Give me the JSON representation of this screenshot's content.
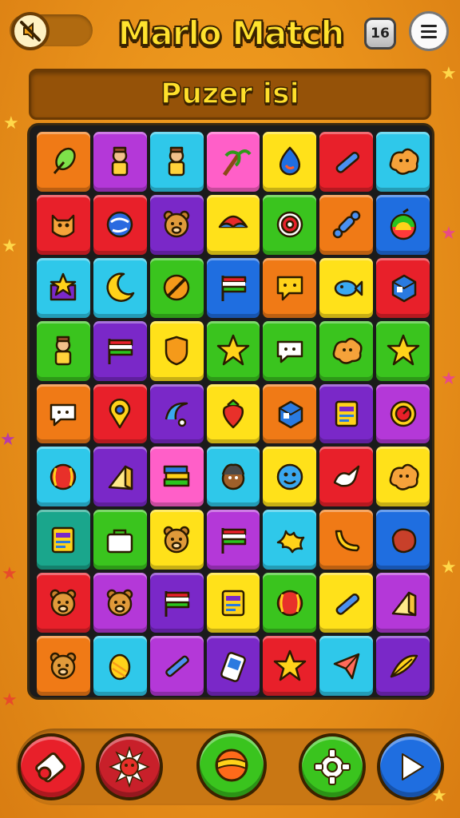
{
  "header": {
    "title": "Marlo Match",
    "moves": "16",
    "subtitle": "Puzer isi"
  },
  "colors": {
    "orange": "#f07a16",
    "magenta": "#b438d8",
    "cyan": "#2fc8ea",
    "pink": "#ff5fc8",
    "yellow": "#ffe11a",
    "red": "#e8202a",
    "purple": "#7a28c8",
    "green": "#3ac41e",
    "blue": "#1f6ee0",
    "teal": "#1aa68c"
  },
  "board": {
    "rows": 9,
    "cols": 7,
    "tiles": [
      [
        {
          "c": "orange",
          "i": "leaf"
        },
        {
          "c": "magenta",
          "i": "doll"
        },
        {
          "c": "cyan",
          "i": "doll"
        },
        {
          "c": "pink",
          "i": "palm"
        },
        {
          "c": "yellow",
          "i": "drop"
        },
        {
          "c": "red",
          "i": "wand"
        },
        {
          "c": "cyan",
          "i": "blob"
        }
      ],
      [
        {
          "c": "red",
          "i": "creature"
        },
        {
          "c": "red",
          "i": "globe"
        },
        {
          "c": "purple",
          "i": "bear"
        },
        {
          "c": "yellow",
          "i": "umbrella"
        },
        {
          "c": "green",
          "i": "target"
        },
        {
          "c": "orange",
          "i": "bone"
        },
        {
          "c": "blue",
          "i": "rainbow"
        }
      ],
      [
        {
          "c": "cyan",
          "i": "box-star"
        },
        {
          "c": "cyan",
          "i": "moon"
        },
        {
          "c": "green",
          "i": "no-sign"
        },
        {
          "c": "blue",
          "i": "flag"
        },
        {
          "c": "orange",
          "i": "speech"
        },
        {
          "c": "yellow",
          "i": "fish"
        },
        {
          "c": "red",
          "i": "cube"
        }
      ],
      [
        {
          "c": "green",
          "i": "doll"
        },
        {
          "c": "purple",
          "i": "flag"
        },
        {
          "c": "yellow",
          "i": "shield"
        },
        {
          "c": "green",
          "i": "star"
        },
        {
          "c": "green",
          "i": "speech-white"
        },
        {
          "c": "green",
          "i": "blob"
        },
        {
          "c": "green",
          "i": "star"
        }
      ],
      [
        {
          "c": "orange",
          "i": "speech-white"
        },
        {
          "c": "red",
          "i": "pin"
        },
        {
          "c": "purple",
          "i": "swirl"
        },
        {
          "c": "yellow",
          "i": "strawberry"
        },
        {
          "c": "orange",
          "i": "cube"
        },
        {
          "c": "purple",
          "i": "card"
        },
        {
          "c": "magenta",
          "i": "clock"
        }
      ],
      [
        {
          "c": "cyan",
          "i": "ball"
        },
        {
          "c": "purple",
          "i": "wedge"
        },
        {
          "c": "pink",
          "i": "books"
        },
        {
          "c": "cyan",
          "i": "face"
        },
        {
          "c": "yellow",
          "i": "smiley"
        },
        {
          "c": "red",
          "i": "dove"
        },
        {
          "c": "yellow",
          "i": "blob"
        }
      ],
      [
        {
          "c": "teal",
          "i": "card"
        },
        {
          "c": "green",
          "i": "bag"
        },
        {
          "c": "yellow",
          "i": "bear"
        },
        {
          "c": "magenta",
          "i": "flag"
        },
        {
          "c": "cyan",
          "i": "splash"
        },
        {
          "c": "orange",
          "i": "banana"
        },
        {
          "c": "blue",
          "i": "stone"
        }
      ],
      [
        {
          "c": "red",
          "i": "bear"
        },
        {
          "c": "magenta",
          "i": "bear"
        },
        {
          "c": "purple",
          "i": "flag"
        },
        {
          "c": "yellow",
          "i": "card"
        },
        {
          "c": "green",
          "i": "ball"
        },
        {
          "c": "yellow",
          "i": "wand"
        },
        {
          "c": "magenta",
          "i": "wedge"
        }
      ],
      [
        {
          "c": "orange",
          "i": "bear"
        },
        {
          "c": "cyan",
          "i": "egg"
        },
        {
          "c": "magenta",
          "i": "pen"
        },
        {
          "c": "purple",
          "i": "phone"
        },
        {
          "c": "red",
          "i": "star"
        },
        {
          "c": "cyan",
          "i": "kite"
        },
        {
          "c": "purple",
          "i": "feather"
        }
      ]
    ]
  },
  "buttons": {
    "left1": {
      "icon": "whistle-icon",
      "color": "#e8202a"
    },
    "left2": {
      "icon": "sun-icon",
      "color": "#c8202a"
    },
    "center": {
      "icon": "ball-icon",
      "color": "#3ac41e"
    },
    "right1": {
      "icon": "gear-icon",
      "color": "#3ac41e"
    },
    "right2": {
      "icon": "play-icon",
      "color": "#1f6ee0"
    }
  }
}
